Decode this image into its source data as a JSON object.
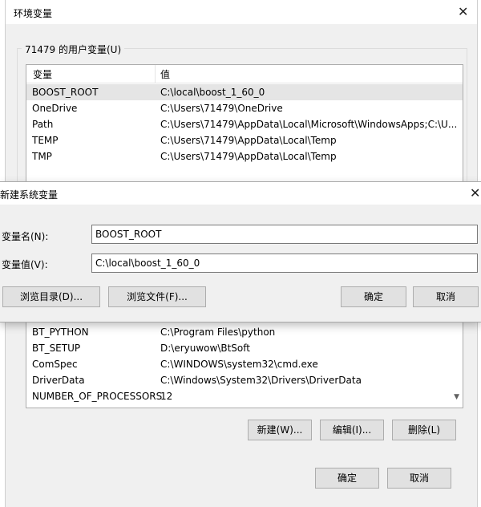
{
  "window": {
    "title": "环境变量",
    "close_glyph": "✕"
  },
  "user_vars": {
    "group_label": "71479 的用户变量(U)",
    "col_var": "变量",
    "col_val": "值",
    "rows": [
      {
        "name": "BOOST_ROOT",
        "value": "C:\\local\\boost_1_60_0"
      },
      {
        "name": "OneDrive",
        "value": "C:\\Users\\71479\\OneDrive"
      },
      {
        "name": "Path",
        "value": "C:\\Users\\71479\\AppData\\Local\\Microsoft\\WindowsApps;C:\\U..."
      },
      {
        "name": "TEMP",
        "value": "C:\\Users\\71479\\AppData\\Local\\Temp"
      },
      {
        "name": "TMP",
        "value": "C:\\Users\\71479\\AppData\\Local\\Temp"
      }
    ]
  },
  "new_dialog": {
    "title": "新建系统变量",
    "close_glyph": "✕",
    "name_label": "变量名(N):",
    "name_value": "BOOST_ROOT",
    "value_label": "变量值(V):",
    "value_value": "C:\\local\\boost_1_60_0",
    "browse_dir": "浏览目录(D)...",
    "browse_file": "浏览文件(F)...",
    "ok": "确定",
    "cancel": "取消"
  },
  "system_vars": {
    "rows": [
      {
        "name": "BT_PYTHON",
        "value": "C:\\Program Files\\python"
      },
      {
        "name": "BT_SETUP",
        "value": "D:\\eryuwow\\BtSoft"
      },
      {
        "name": "ComSpec",
        "value": "C:\\WINDOWS\\system32\\cmd.exe"
      },
      {
        "name": "DriverData",
        "value": "C:\\Windows\\System32\\Drivers\\DriverData"
      },
      {
        "name": "NUMBER_OF_PROCESSORS",
        "value": "12"
      }
    ],
    "new": "新建(W)...",
    "edit": "编辑(I)...",
    "delete": "删除(L)"
  },
  "footer": {
    "ok": "确定",
    "cancel": "取消"
  }
}
